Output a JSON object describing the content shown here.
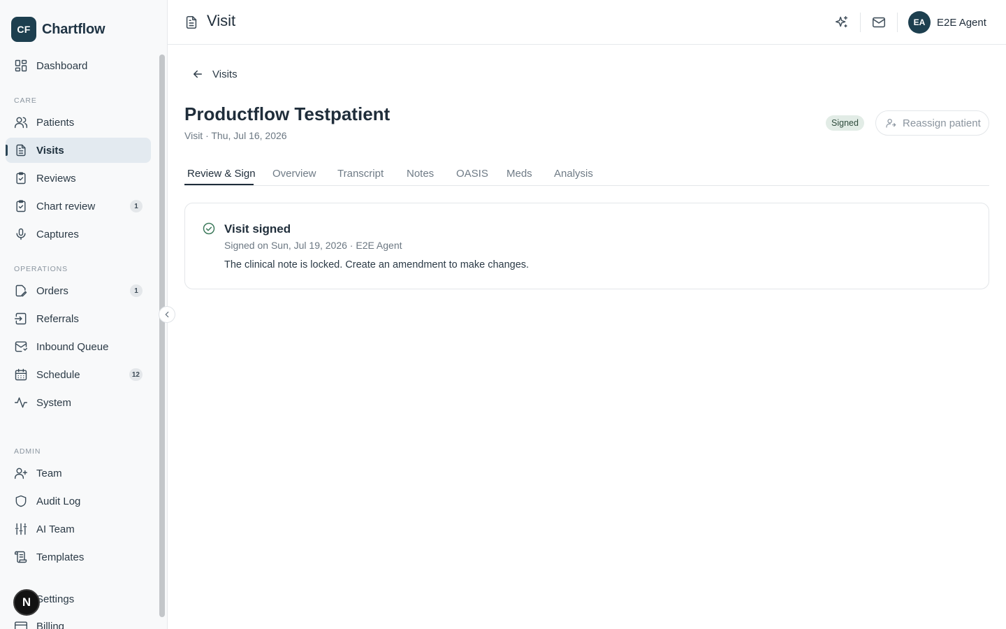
{
  "app": {
    "logo_initials": "CF",
    "name": "Chartflow"
  },
  "sidebar": {
    "top_item": {
      "label": "Dashboard",
      "icon": "dashboard-icon"
    },
    "sections": {
      "care": "CARE",
      "operations": "OPERATIONS",
      "admin": "ADMIN"
    },
    "care_items": [
      {
        "label": "Patients",
        "icon": "users-icon"
      },
      {
        "label": "Visits",
        "icon": "document-icon",
        "active": true
      },
      {
        "label": "Reviews",
        "icon": "clipboard-check-icon"
      },
      {
        "label": "Chart review",
        "icon": "clipboard-check-icon",
        "badge": "1"
      },
      {
        "label": "Captures",
        "icon": "microphone-icon"
      }
    ],
    "operations_items": [
      {
        "label": "Orders",
        "icon": "edit-document-icon",
        "badge": "1"
      },
      {
        "label": "Referrals",
        "icon": "inbox-in-icon"
      },
      {
        "label": "Inbound Queue",
        "icon": "mail-icon"
      },
      {
        "label": "Schedule",
        "icon": "calendar-icon",
        "badge": "12"
      },
      {
        "label": "System",
        "icon": "activity-icon"
      }
    ],
    "admin_items": [
      {
        "label": "Team",
        "icon": "user-plus-icon"
      },
      {
        "label": "Audit Log",
        "icon": "shield-icon"
      },
      {
        "label": "AI Team",
        "icon": "sliders-icon"
      },
      {
        "label": "Templates",
        "icon": "scroll-icon"
      },
      {
        "label": "Settings",
        "icon": "gear-icon"
      },
      {
        "label": "Billing",
        "icon": "credit-card-icon"
      }
    ],
    "floating_badge": "N"
  },
  "header": {
    "title": "Visit",
    "title_icon": "document-icon",
    "user": {
      "initials": "EA",
      "name": "E2E Agent"
    }
  },
  "main": {
    "back_label": "Visits",
    "patient_name": "Productflow Testpatient",
    "subtitle": "Visit · Thu, Jul 16, 2026",
    "status": "Signed",
    "reassign_label": "Reassign patient",
    "tabs": [
      "Review & Sign",
      "Overview",
      "Transcript",
      "Notes",
      "OASIS",
      "Meds",
      "Analysis"
    ],
    "card": {
      "title": "Visit signed",
      "meta": "Signed on Sun, Jul 19, 2026 · E2E Agent",
      "message": "The clinical note is locked. Create an amendment to make changes."
    }
  },
  "colors": {
    "brand": "#1d3f4f",
    "active_nav_bg": "#e3eaf0",
    "signed_badge_bg": "#e2ece6",
    "success_icon": "#3d7a5c"
  }
}
